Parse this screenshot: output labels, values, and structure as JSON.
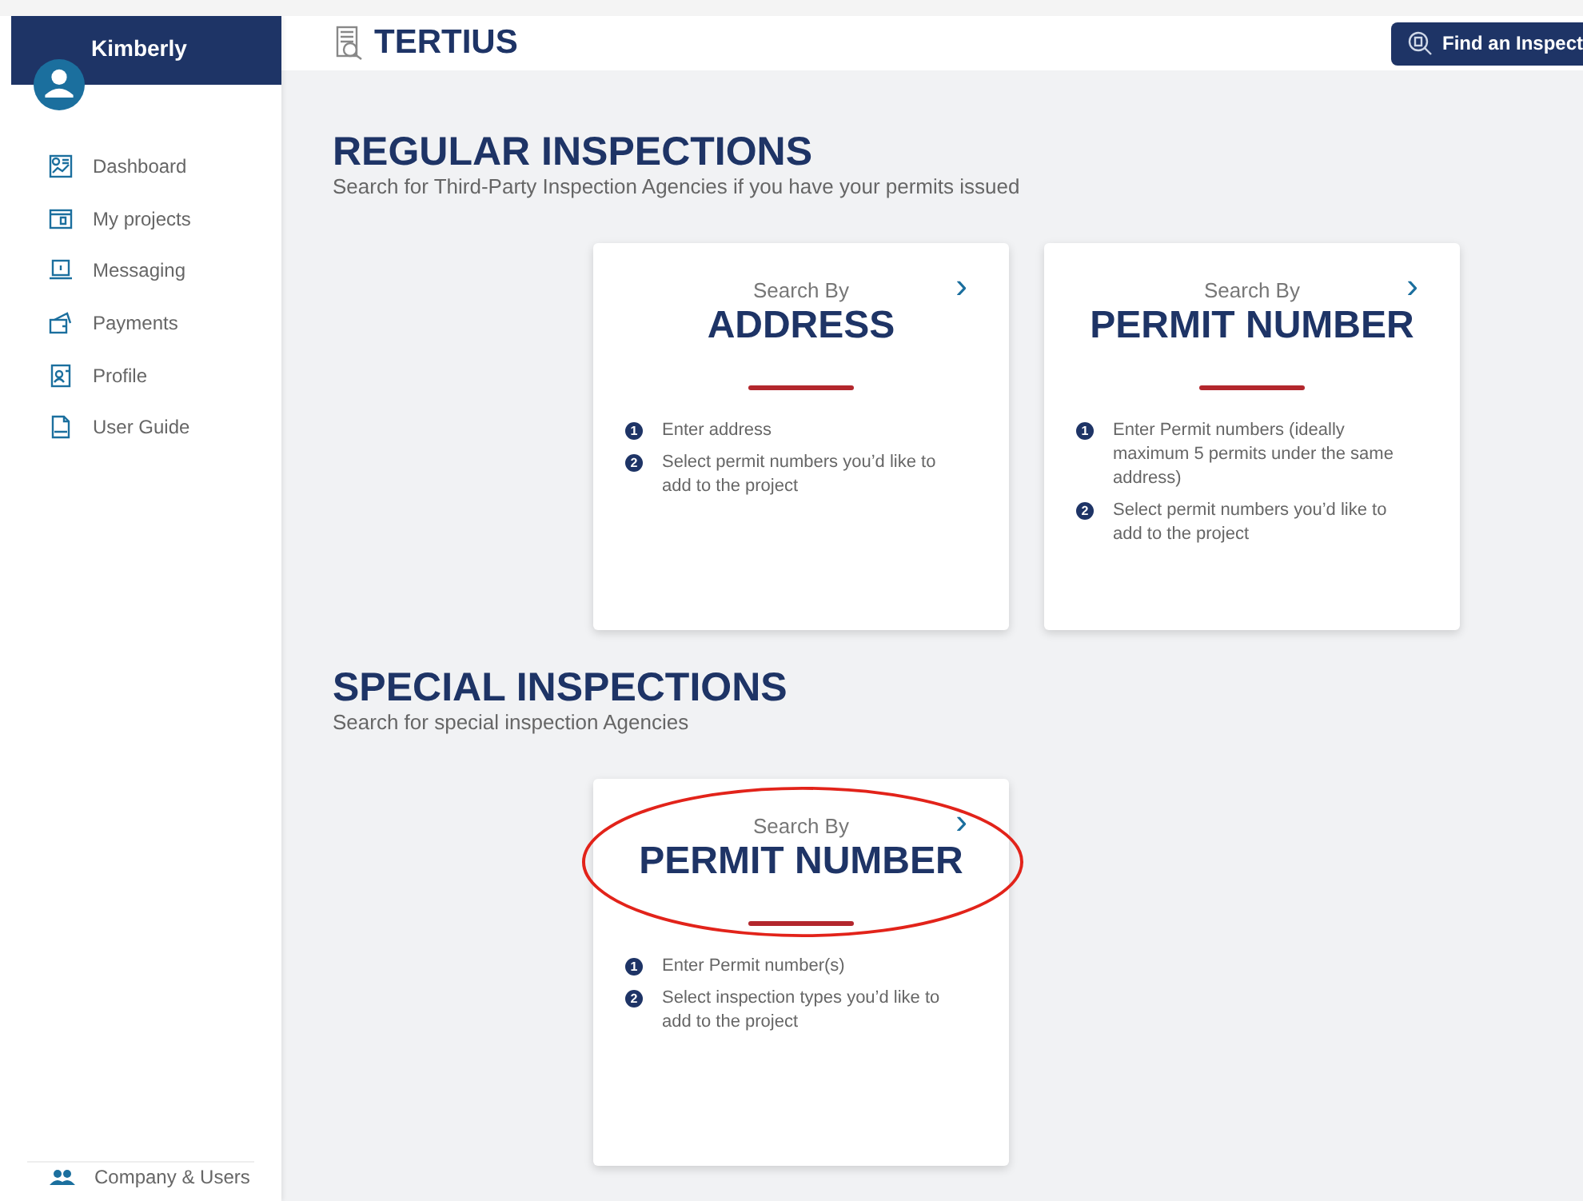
{
  "sidebar": {
    "user": "Kimberly",
    "items": [
      {
        "label": "Dashboard"
      },
      {
        "label": "My projects"
      },
      {
        "label": "Messaging"
      },
      {
        "label": "Payments"
      },
      {
        "label": "Profile"
      },
      {
        "label": "User Guide"
      }
    ],
    "footer_item": {
      "label": "Company & Users"
    }
  },
  "header": {
    "logo": "TERTIUS",
    "button": "Find an Inspect"
  },
  "sections": [
    {
      "title": "REGULAR INSPECTIONS",
      "subtitle": "Search for Third-Party Inspection Agencies if you have your permits issued",
      "cards": [
        {
          "kicker": "Search By",
          "heading": "ADDRESS",
          "arrow": "›",
          "highlighted": false,
          "steps": [
            {
              "n": "1",
              "text": "Enter address"
            },
            {
              "n": "2",
              "text": "Select permit numbers you’d like to add to the project"
            }
          ]
        },
        {
          "kicker": "Search By",
          "heading": "PERMIT NUMBER",
          "arrow": "›",
          "highlighted": false,
          "steps": [
            {
              "n": "1",
              "text": "Enter Permit numbers (ideally maximum 5 permits under the same address)"
            },
            {
              "n": "2",
              "text": "Select permit numbers you’d like to add to the project"
            }
          ]
        }
      ]
    },
    {
      "title": "SPECIAL INSPECTIONS",
      "subtitle": "Search for special inspection Agencies",
      "cards": [
        {
          "kicker": "Search By",
          "heading": "PERMIT NUMBER",
          "arrow": "›",
          "highlighted": true,
          "steps": [
            {
              "n": "1",
              "text": "Enter Permit number(s)"
            },
            {
              "n": "2",
              "text": "Select inspection types you’d like to add to the project"
            }
          ]
        }
      ]
    }
  ]
}
